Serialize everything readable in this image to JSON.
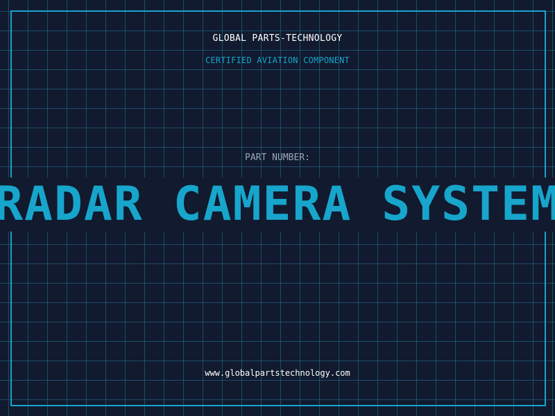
{
  "header": {
    "company": "GLOBAL PARTS-TECHNOLOGY",
    "subtitle": "CERTIFIED AVIATION COMPONENT"
  },
  "part": {
    "label": "PART NUMBER:",
    "value": "RADAR CAMERA SYSTEM"
  },
  "footer": {
    "website": "www.globalpartstechnology.com"
  },
  "colors": {
    "background": "#111a2e",
    "accent": "#17a5cc",
    "text": "#ffffff",
    "muted": "#9aa8bc"
  }
}
